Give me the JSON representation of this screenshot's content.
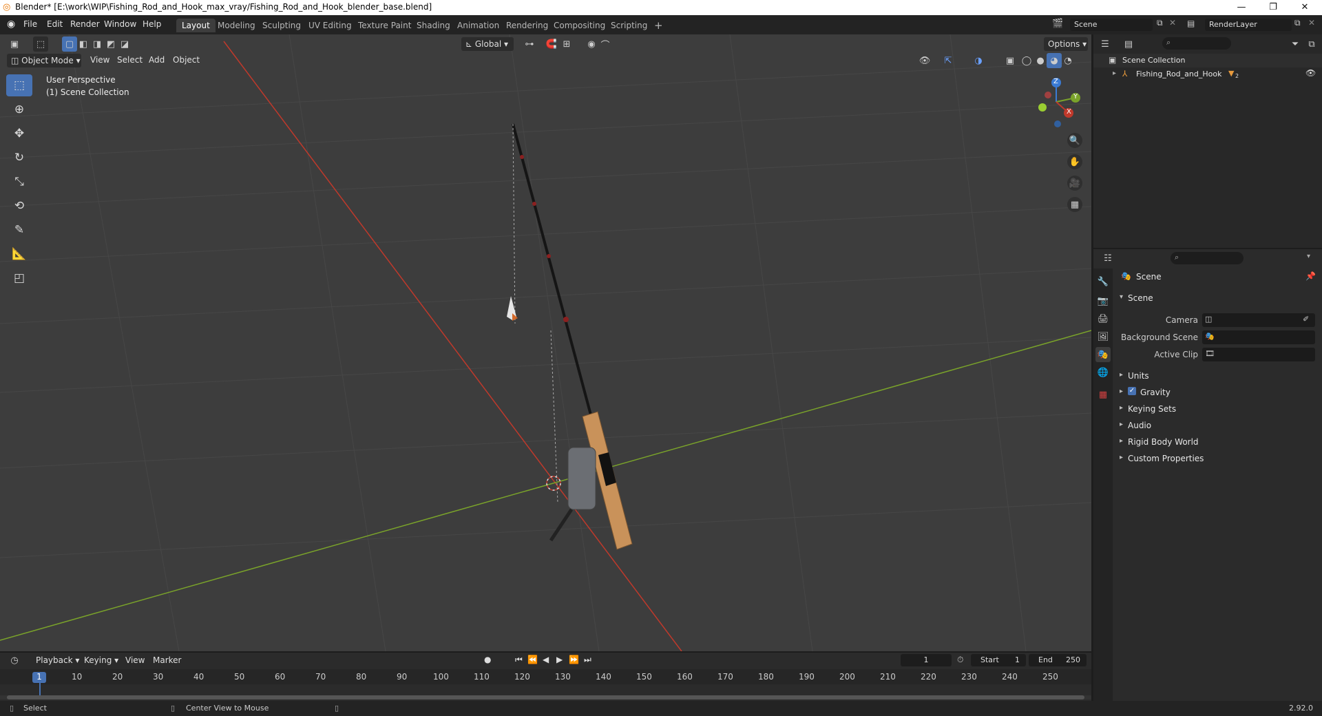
{
  "window": {
    "title": "Blender* [E:\\work\\WIP\\Fishing_Rod_and_Hook_max_vray/Fishing_Rod_and_Hook_blender_base.blend]",
    "minimize": "—",
    "maximize": "❐",
    "close": "✕"
  },
  "menu": [
    "File",
    "Edit",
    "Render",
    "Window",
    "Help"
  ],
  "workspaces": [
    "Layout",
    "Modeling",
    "Sculpting",
    "UV Editing",
    "Texture Paint",
    "Shading",
    "Animation",
    "Rendering",
    "Compositing",
    "Scripting"
  ],
  "add_workspace": "+",
  "scene": {
    "name": "Scene"
  },
  "view_layer": {
    "name": "RenderLayer"
  },
  "viewport": {
    "mode": "Object Mode",
    "menus": [
      "View",
      "Select",
      "Add",
      "Object"
    ],
    "transform_orientation": "Global",
    "options": "Options",
    "overlay_line1": "User Perspective",
    "overlay_line2": "(1) Scene Collection",
    "gizmo_x": "X",
    "gizmo_y": "Y",
    "gizmo_z": "Z"
  },
  "outliner": {
    "root": "Scene Collection",
    "items": [
      {
        "label": "Fishing_Rod_and_Hook",
        "badge": "2"
      }
    ]
  },
  "properties": {
    "context": "Scene",
    "panel": "Scene",
    "fields": [
      {
        "label": "Camera",
        "value": ""
      },
      {
        "label": "Background Scene",
        "value": ""
      },
      {
        "label": "Active Clip",
        "value": ""
      }
    ],
    "sections": [
      {
        "label": "Units",
        "checkbox": false
      },
      {
        "label": "Gravity",
        "checkbox": true
      },
      {
        "label": "Keying Sets",
        "checkbox": false
      },
      {
        "label": "Audio",
        "checkbox": false
      },
      {
        "label": "Rigid Body World",
        "checkbox": false
      },
      {
        "label": "Custom Properties",
        "checkbox": false
      }
    ]
  },
  "timeline": {
    "menus": [
      "Playback",
      "Keying",
      "View",
      "Marker"
    ],
    "current_frame": "1",
    "start_label": "Start",
    "start": "1",
    "end_label": "End",
    "end": "250",
    "ticks": [
      "1",
      "10",
      "20",
      "30",
      "40",
      "50",
      "60",
      "70",
      "80",
      "90",
      "100",
      "110",
      "120",
      "130",
      "140",
      "150",
      "160",
      "170",
      "180",
      "190",
      "200",
      "210",
      "220",
      "230",
      "240",
      "250"
    ]
  },
  "status": {
    "left": "Select",
    "middle": "Center View to Mouse",
    "version": "2.92.0"
  },
  "colors": {
    "accent": "#4772b3",
    "x_axis": "#c0392b",
    "y_axis": "#7aa32a",
    "cork": "#c9925a"
  }
}
